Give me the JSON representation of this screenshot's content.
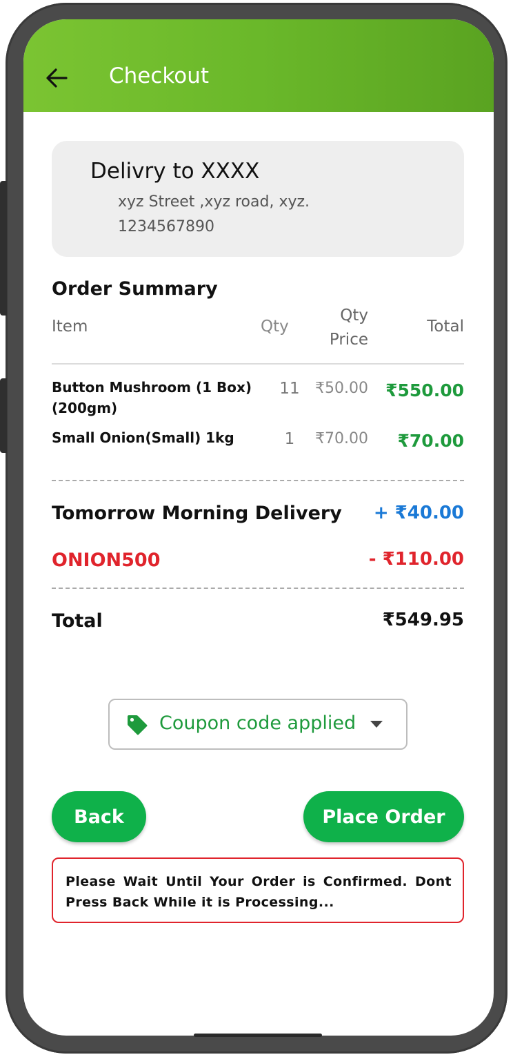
{
  "header": {
    "title": "Checkout",
    "background": "#6ab82a"
  },
  "address": {
    "title": "Delivry to XXXX",
    "line1": "xyz Street ,xyz road, xyz.",
    "phone": "1234567890"
  },
  "summary": {
    "heading": "Order Summary",
    "columns": {
      "item": "Item",
      "qty": "Qty",
      "qty_price": "Qty Price",
      "total": "Total"
    },
    "items": [
      {
        "name": "Button Mushroom (1 Box) (200gm)",
        "qty": "11",
        "unit_price": "₹50.00",
        "total": "₹550.00"
      },
      {
        "name": "Small Onion(Small) 1kg",
        "qty": "1",
        "unit_price": "₹70.00",
        "total": "₹70.00"
      }
    ]
  },
  "charges": {
    "delivery_label": "Tomorrow Morning Delivery",
    "delivery_value": "+ ₹40.00",
    "coupon_code": "ONION500",
    "coupon_value": "- ₹110.00",
    "total_label": "Total",
    "total_value": "₹549.95"
  },
  "coupon": {
    "status_text": "Coupon code applied",
    "icon": "tag-icon"
  },
  "actions": {
    "back_label": "Back",
    "place_order_label": "Place Order"
  },
  "notice": {
    "text": "Please Wait Until Your Order is Confirmed. Dont Press Back While it is Processing..."
  },
  "colors": {
    "accent_green": "#0fb14a",
    "price_green": "#1e9a3c",
    "fee_blue": "#1a79d6",
    "alert_red": "#e0242c"
  }
}
